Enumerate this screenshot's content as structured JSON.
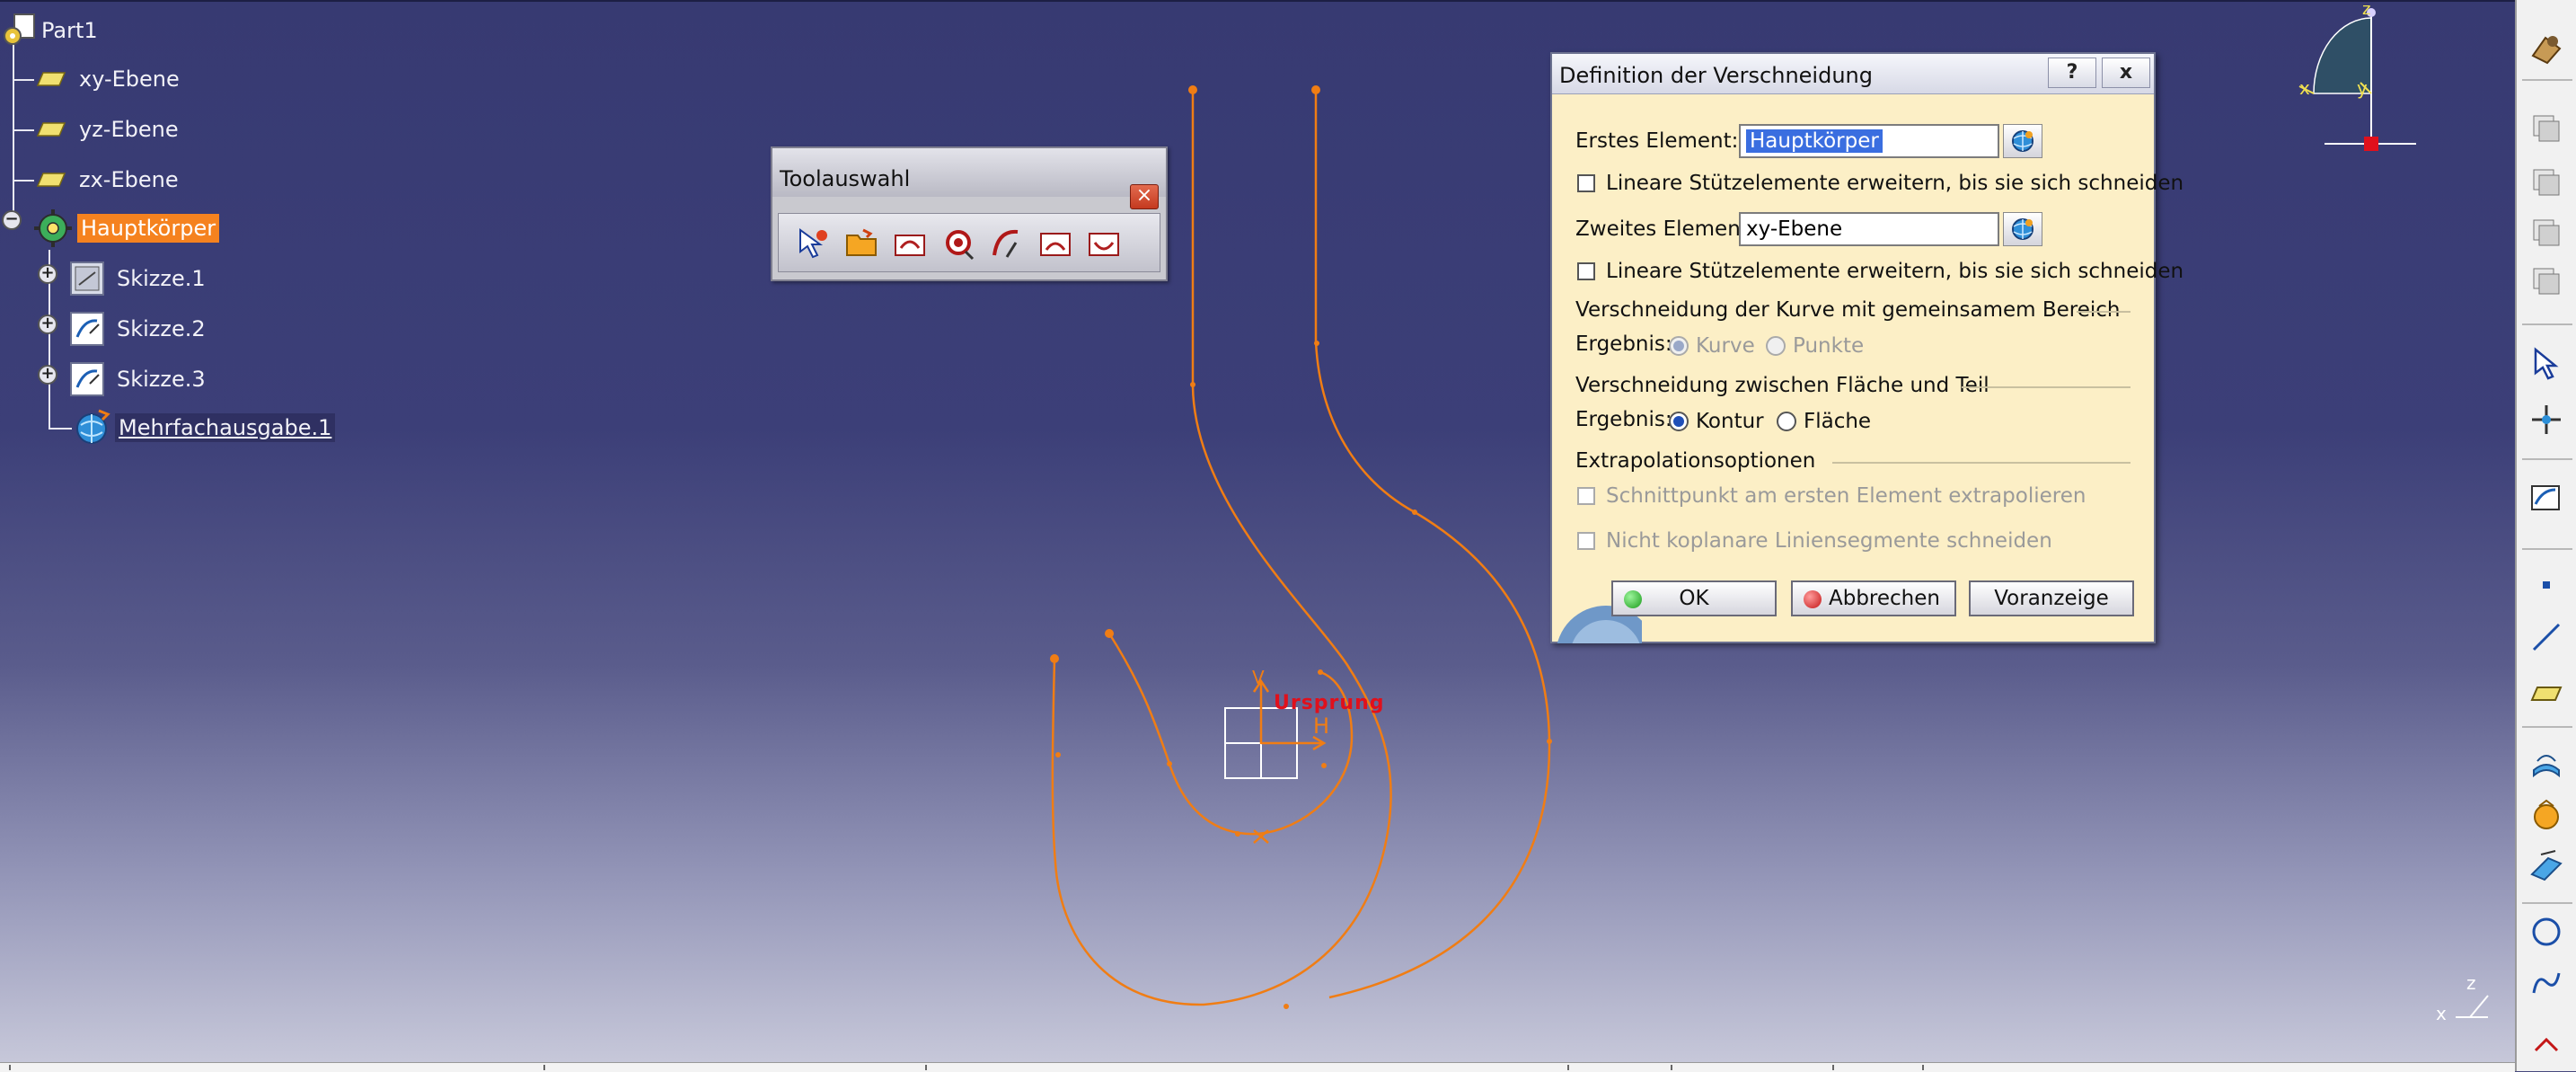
{
  "spec_tree": {
    "root": "Part1",
    "planes": [
      "xy-Ebene",
      "yz-Ebene",
      "zx-Ebene"
    ],
    "body": "Hauptkörper",
    "sketches": [
      "Skizze.1",
      "Skizze.2",
      "Skizze.3"
    ],
    "multi_output": "Mehrfachausgabe.1"
  },
  "toolbox": {
    "title": "Toolauswahl",
    "close_glyph": "×"
  },
  "dialog": {
    "title": "Definition der Verschneidung",
    "help_glyph": "?",
    "close_glyph": "x",
    "first_element_label": "Erstes Element:",
    "first_element_value": "Hauptkörper",
    "extend_supports_1": "Lineare Stützelemente erweitern, bis sie sich schneiden",
    "second_element_label": "Zweites Element:",
    "second_element_value": "xy-Ebene",
    "extend_supports_2": "Lineare Stützelemente erweitern, bis sie sich schneiden",
    "section_curve": "Verschneidung der Kurve mit gemeinsamem Bereich",
    "result_label_1": "Ergebnis:",
    "result_curve": "Kurve",
    "result_points": "Punkte",
    "section_surface": "Verschneidung zwischen Fläche und Teil",
    "result_label_2": "Ergebnis:",
    "result_contour": "Kontur",
    "result_surface": "Fläche",
    "section_extrapolation": "Extrapolationsoptionen",
    "extrapolate_first": "Schnittpunkt am ersten Element extrapolieren",
    "cut_noncoplanar": "Nicht koplanare Liniensegmente schneiden",
    "ok": "OK",
    "cancel": "Abbrechen",
    "preview": "Voranzeige"
  },
  "viewport": {
    "sketch_label": "Ursprung",
    "axis_h": "H",
    "axis_v": "V"
  },
  "compass": {
    "x": "x",
    "y": "y",
    "z": "z"
  },
  "mini_axes": {
    "x": "x",
    "z": "z"
  },
  "colors": {
    "background_top": "#373a72",
    "background_bottom": "#c9cadb",
    "geometry": "#f07d14",
    "selection": "#f5821f",
    "dialog_bg": "#fcefc6"
  }
}
